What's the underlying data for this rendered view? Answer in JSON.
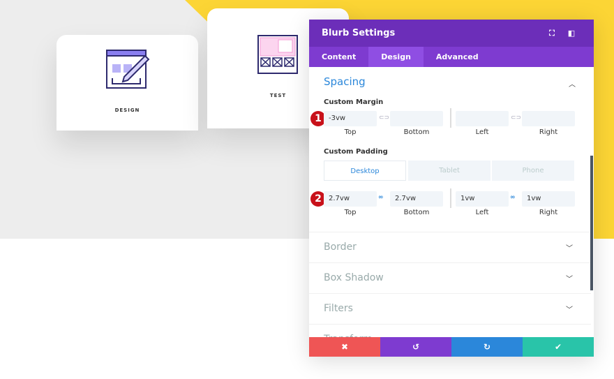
{
  "cards": [
    {
      "label": "DESIGN",
      "icon": "design-pencil-icon"
    },
    {
      "label": "TEST",
      "icon": "wireframe-icon"
    }
  ],
  "panel": {
    "title": "Blurb Settings",
    "header_icons": [
      "fullscreen-icon",
      "split-view-icon"
    ],
    "tabs": [
      {
        "label": "Content"
      },
      {
        "label": "Design",
        "active": true
      },
      {
        "label": "Advanced"
      }
    ],
    "section": "Spacing",
    "margin": {
      "label": "Custom Margin",
      "badge": "1",
      "values": [
        "-3vw",
        "",
        "",
        ""
      ],
      "captions": [
        "Top",
        "Bottom",
        "Left",
        "Right"
      ]
    },
    "padding": {
      "label": "Custom Padding",
      "badge": "2",
      "devices": [
        "Desktop",
        "Tablet",
        "Phone"
      ],
      "values": [
        "2.7vw",
        "2.7vw",
        "1vw",
        "1vw"
      ],
      "captions": [
        "Top",
        "Bottom",
        "Left",
        "Right"
      ]
    },
    "collapsed": [
      "Border",
      "Box Shadow",
      "Filters",
      "Transform"
    ],
    "footer": {
      "cancel": "✖",
      "undo": "↺",
      "redo": "↻",
      "save": "✔"
    }
  },
  "colors": {
    "header": "#6c2eb9",
    "accent": "#2b87da",
    "cancel": "#ef5555",
    "undo": "#7e3bd0",
    "redo": "#2b87da",
    "save": "#29c4a9",
    "yellow": "#fcd535"
  }
}
